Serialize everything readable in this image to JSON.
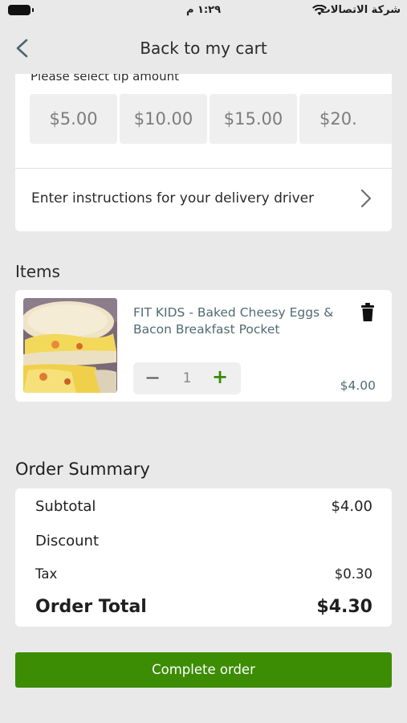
{
  "status_bar": {
    "time": "١:٢٩ م",
    "carrier": "شركة الاتصالات",
    "icons": [
      "battery-icon",
      "wifi-icon"
    ]
  },
  "header": {
    "back_icon": "chevron-left-icon",
    "title": "Back to my cart"
  },
  "tip": {
    "label": "Please select tip amount",
    "options": [
      "$5.00",
      "$10.00",
      "$15.00",
      "$20."
    ]
  },
  "instructions": {
    "label": "Enter instructions for your delivery driver",
    "icon": "chevron-right-icon"
  },
  "items": {
    "heading": "Items",
    "list": [
      {
        "name": "FIT KIDS - Baked Cheesy Eggs & Bacon Breakfast Pocket",
        "quantity": "1",
        "price": "$4.00",
        "minus_label": "−",
        "plus_label": "+"
      }
    ]
  },
  "summary": {
    "heading": "Order Summary",
    "subtotal_label": "Subtotal",
    "subtotal_value": "$4.00",
    "discount_label": "Discount",
    "tax_label": "Tax",
    "tax_value": "$0.30",
    "total_label": "Order Total",
    "total_value": "$4.30"
  },
  "actions": {
    "complete_label": "Complete order"
  },
  "colors": {
    "accent_green": "#3c8c04",
    "item_text": "#4f6b73",
    "background": "#e9e9e9"
  }
}
